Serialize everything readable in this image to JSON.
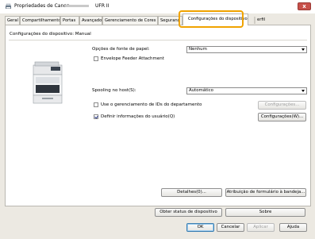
{
  "window": {
    "title_prefix": "Propriedades de Canon",
    "title_suffix": "UFR II",
    "close_label": "x"
  },
  "tabs": [
    {
      "label": "Geral",
      "active": false
    },
    {
      "label": "Compartilhamento",
      "active": false
    },
    {
      "label": "Portas",
      "active": false
    },
    {
      "label": "Avançado",
      "active": false
    },
    {
      "label": "Gerenciamento de Cores",
      "active": false
    },
    {
      "label": "Seguranç",
      "active": false
    },
    {
      "label": "Configurações do dispositivo",
      "active": true
    }
  ],
  "tab_overflow_label": "erfil",
  "panel": {
    "heading": "Configurações do dispositivo: Manual",
    "paper_source_label": "Opções de fonte de papel:",
    "paper_source_value": "Nenhum",
    "envelope_feeder_label": "Envelope Feeder Attachment",
    "envelope_feeder_checked": false,
    "spooling_label": "Spooling no host(S):",
    "spooling_value": "Automático",
    "dept_id_label": "Use o gerenciamento de IDs do departamento",
    "dept_id_checked": false,
    "dept_settings_button": "Configurações...",
    "user_info_label": "Definir informações do usuário(Q)",
    "user_info_checked": true,
    "user_settings_button": "Configurações(W)...",
    "details_button": "Detalhes(0)...",
    "form_assignment_button": "Atribuição de formulário à bandeja...",
    "get_status_button": "Obter status de dispositivo",
    "about_button": "Sobre"
  },
  "footer": {
    "ok": "OK",
    "cancel": "Cancelar",
    "apply": "Aplicar",
    "help": "Ajuda"
  },
  "colors": {
    "tab_highlight": "#f0a300",
    "close_button": "#c7504a"
  }
}
